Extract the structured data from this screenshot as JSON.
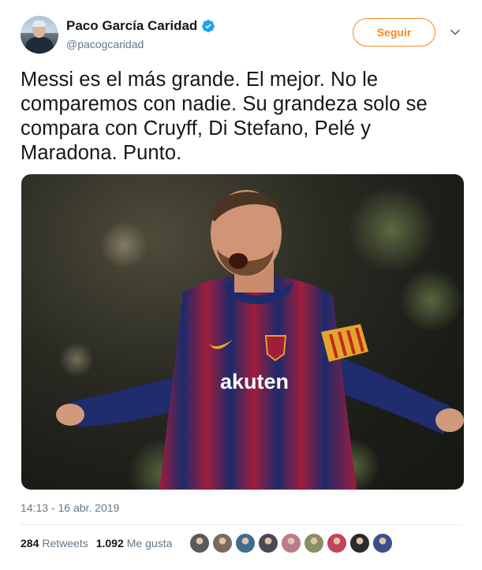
{
  "author": {
    "display_name": "Paco García Caridad",
    "handle": "@pacogcaridad",
    "verified": true
  },
  "follow_button": {
    "label": "Seguir"
  },
  "tweet": {
    "text": "Messi es el más grande. El mejor. No le comparemos con nadie. Su grandeza solo se compara con Cruyff, Di Stefano, Pelé y Maradona. Punto.",
    "timestamp": "14:13 - 16 abr. 2019"
  },
  "photo": {
    "shirt_sponsor": "akuten"
  },
  "stats": {
    "retweets_count": "284",
    "retweets_label": "Retweets",
    "likes_count": "1.092",
    "likes_label": "Me gusta"
  },
  "likers": [
    {
      "icon": "avatar",
      "color": "#5a5a5a"
    },
    {
      "icon": "avatar",
      "color": "#7a6b5e"
    },
    {
      "icon": "avatar",
      "color": "#3e6e8e"
    },
    {
      "icon": "avatar",
      "color": "#4a4a55"
    },
    {
      "icon": "avatar",
      "color": "#b87c8a"
    },
    {
      "icon": "avatar",
      "color": "#8a8e64"
    },
    {
      "icon": "avatar",
      "color": "#c0455c"
    },
    {
      "icon": "avatar",
      "color": "#2b2b2b"
    },
    {
      "icon": "avatar",
      "color": "#3b4f8c"
    }
  ],
  "colors": {
    "accent": "#f4891f",
    "verified": "#1da1f2",
    "secondary_text": "#657786"
  }
}
